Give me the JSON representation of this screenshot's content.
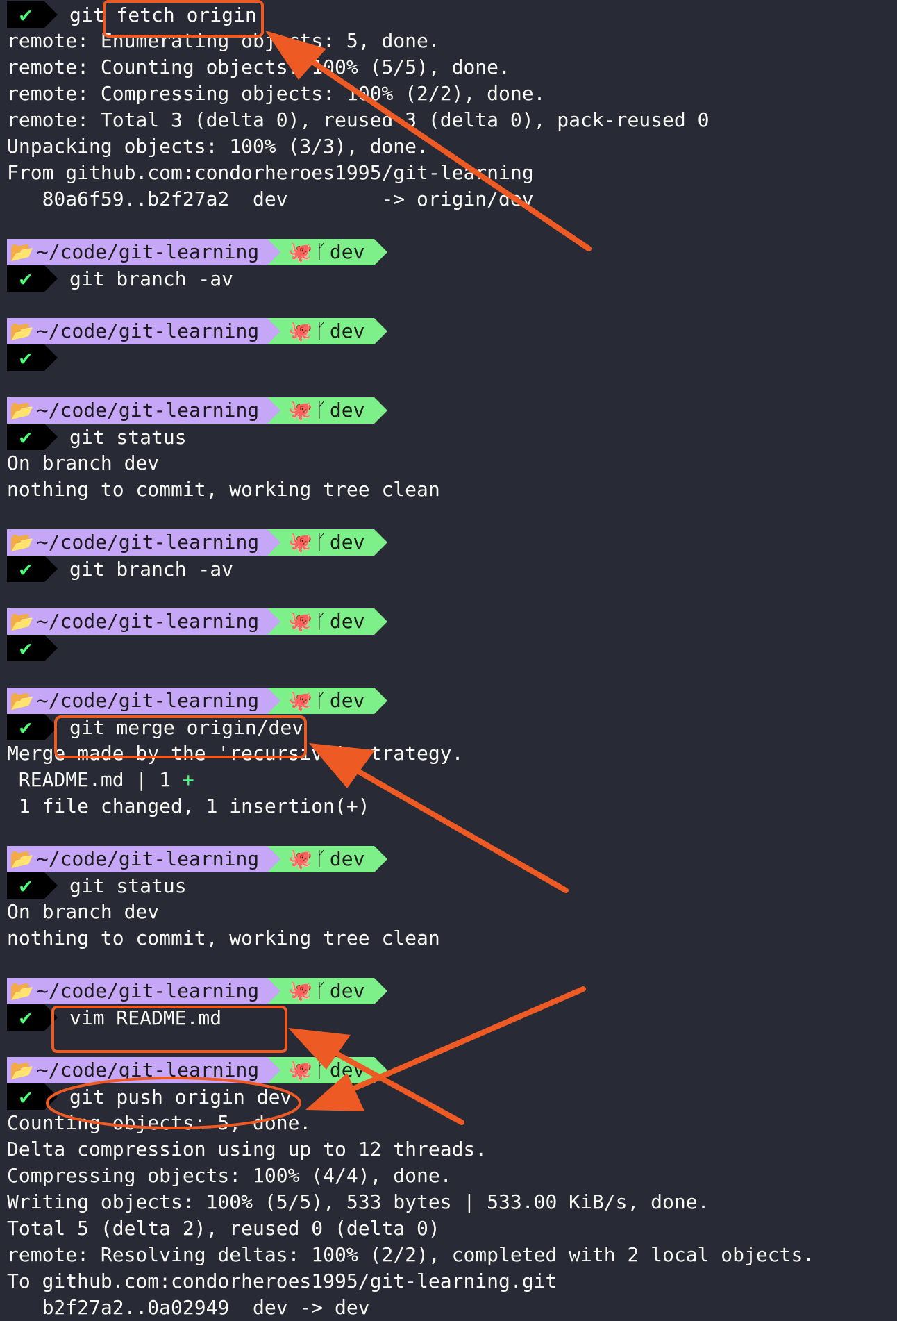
{
  "prompt": {
    "path": "~/code/git-learning",
    "branch": "dev"
  },
  "lines": {
    "l0": "git fetch origin",
    "l1": "remote: Enumerating objects: 5, done.",
    "l2": "remote: Counting objects: 100% (5/5), done.",
    "l3": "remote: Compressing objects: 100% (2/2), done.",
    "l4": "remote: Total 3 (delta 0), reused 3 (delta 0), pack-reused 0",
    "l5": "Unpacking objects: 100% (3/3), done.",
    "l6": "From github.com:condorheroes1995/git-learning",
    "l7": "   80a6f59..b2f27a2  dev        -> origin/dev",
    "c1": "git branch -av",
    "c3": "git status",
    "o3a": "On branch dev",
    "o3b": "nothing to commit, working tree clean",
    "c4": "git branch -av",
    "c6": "git merge origin/dev",
    "o6a": "Merge made by the 'recursive' strategy.",
    "o6b": " README.md | 1 ",
    "o6b_plus": "+",
    "o6c": " 1 file changed, 1 insertion(+)",
    "c7": "git status",
    "o7a": "On branch dev",
    "o7b": "nothing to commit, working tree clean",
    "c8": "vim README.md",
    "c9": "git push origin dev",
    "o9a": "Counting objects: 5, done.",
    "o9b": "Delta compression using up to 12 threads.",
    "o9c": "Compressing objects: 100% (4/4), done.",
    "o9d": "Writing objects: 100% (5/5), 533 bytes | 533.00 KiB/s, done.",
    "o9e": "Total 5 (delta 2), reused 0 (delta 0)",
    "o9f": "remote: Resolving deltas: 100% (2/2), completed with 2 local objects.",
    "o9g": "To github.com:condorheroes1995/git-learning.git",
    "o9h": "   b2f27a2..0a02949  dev -> dev"
  },
  "colors": {
    "background": "#282a36",
    "path_segment": "#c6a6f6",
    "git_segment": "#7ef08a",
    "check": "#50fa7b",
    "annotation": "#ee5a24"
  }
}
